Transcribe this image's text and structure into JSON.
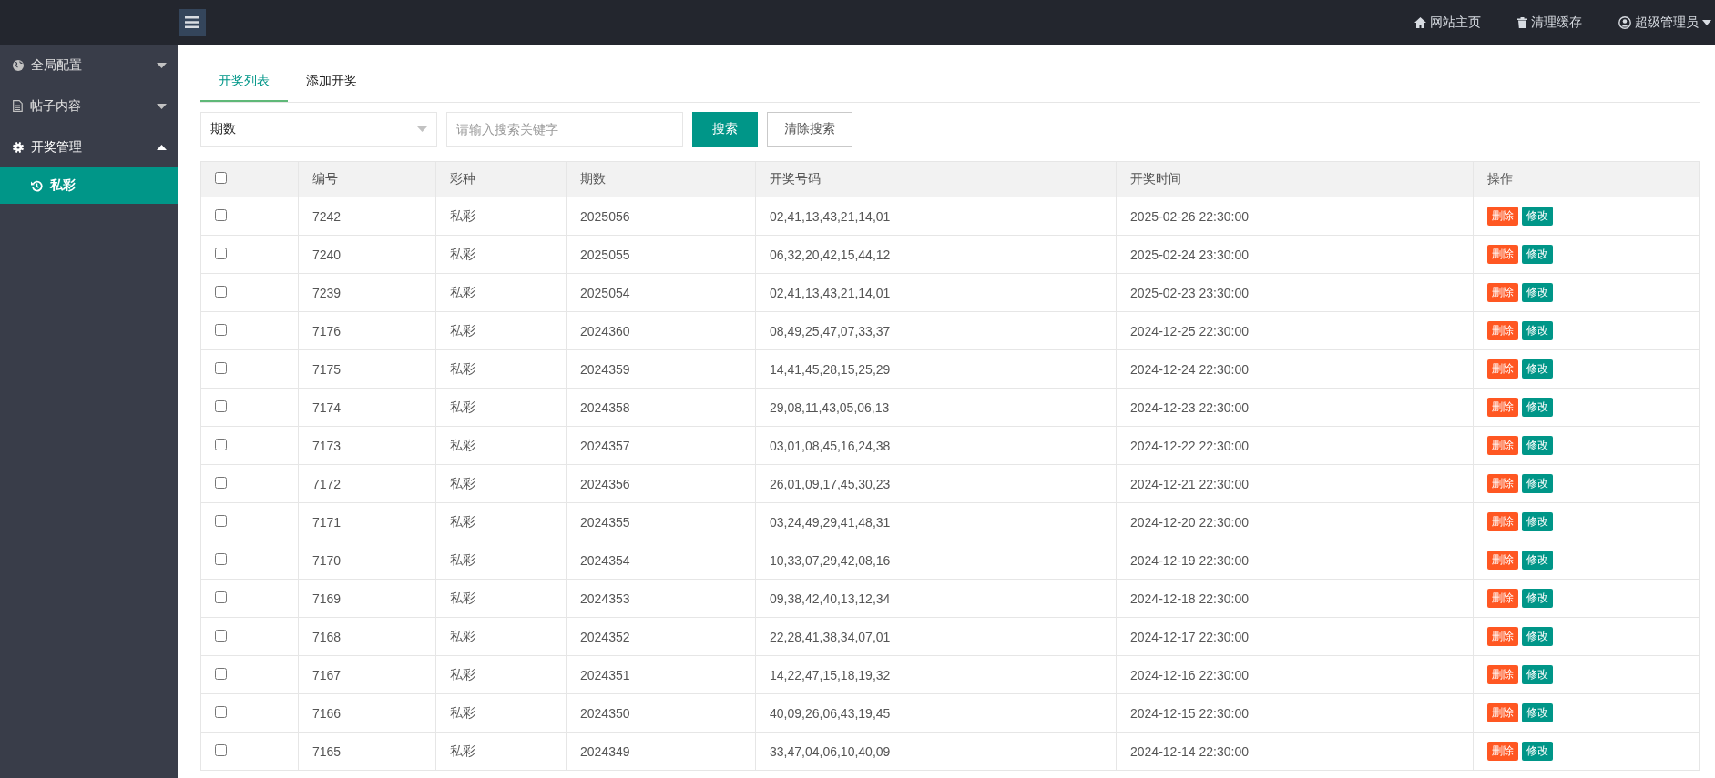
{
  "header": {
    "links": [
      {
        "kind": "home",
        "label": "网站主页"
      },
      {
        "kind": "trash",
        "label": "清理缓存"
      },
      {
        "kind": "user",
        "label": "超级管理员"
      }
    ]
  },
  "sidebar": {
    "items": [
      {
        "kind": "globe",
        "label": "全局配置",
        "expanded": false
      },
      {
        "kind": "file",
        "label": "帖子内容",
        "expanded": false
      },
      {
        "kind": "gear",
        "label": "开奖管理",
        "expanded": true,
        "children": [
          {
            "kind": "history",
            "label": "私彩",
            "selected": true
          }
        ]
      }
    ]
  },
  "tabs": [
    {
      "label": "开奖列表",
      "selected": true
    },
    {
      "label": "添加开奖",
      "selected": false
    }
  ],
  "search": {
    "select_value": "期数",
    "placeholder": "请输入搜索关键字",
    "search_button": "搜索",
    "clear_button": "清除搜索"
  },
  "table": {
    "all_checked": false,
    "columns": [
      "编号",
      "彩种",
      "期数",
      "开奖号码",
      "开奖时间",
      "操作"
    ],
    "rows": [
      {
        "checked": false,
        "id": "7242",
        "type": "私彩",
        "period": "2025056",
        "numbers": "02,41,13,43,21,14,01",
        "time": "2025-02-26 22:30:00",
        "actions": [
          "删除",
          "修改"
        ]
      },
      {
        "checked": false,
        "id": "7240",
        "type": "私彩",
        "period": "2025055",
        "numbers": "06,32,20,42,15,44,12",
        "time": "2025-02-24 23:30:00",
        "actions": [
          "删除",
          "修改"
        ]
      },
      {
        "checked": false,
        "id": "7239",
        "type": "私彩",
        "period": "2025054",
        "numbers": "02,41,13,43,21,14,01",
        "time": "2025-02-23 23:30:00",
        "actions": [
          "删除",
          "修改"
        ]
      },
      {
        "checked": false,
        "id": "7176",
        "type": "私彩",
        "period": "2024360",
        "numbers": "08,49,25,47,07,33,37",
        "time": "2024-12-25 22:30:00",
        "actions": [
          "删除",
          "修改"
        ]
      },
      {
        "checked": false,
        "id": "7175",
        "type": "私彩",
        "period": "2024359",
        "numbers": "14,41,45,28,15,25,29",
        "time": "2024-12-24 22:30:00",
        "actions": [
          "删除",
          "修改"
        ]
      },
      {
        "checked": false,
        "id": "7174",
        "type": "私彩",
        "period": "2024358",
        "numbers": "29,08,11,43,05,06,13",
        "time": "2024-12-23 22:30:00",
        "actions": [
          "删除",
          "修改"
        ]
      },
      {
        "checked": false,
        "id": "7173",
        "type": "私彩",
        "period": "2024357",
        "numbers": "03,01,08,45,16,24,38",
        "time": "2024-12-22 22:30:00",
        "actions": [
          "删除",
          "修改"
        ]
      },
      {
        "checked": false,
        "id": "7172",
        "type": "私彩",
        "period": "2024356",
        "numbers": "26,01,09,17,45,30,23",
        "time": "2024-12-21 22:30:00",
        "actions": [
          "删除",
          "修改"
        ]
      },
      {
        "checked": false,
        "id": "7171",
        "type": "私彩",
        "period": "2024355",
        "numbers": "03,24,49,29,41,48,31",
        "time": "2024-12-20 22:30:00",
        "actions": [
          "删除",
          "修改"
        ]
      },
      {
        "checked": false,
        "id": "7170",
        "type": "私彩",
        "period": "2024354",
        "numbers": "10,33,07,29,42,08,16",
        "time": "2024-12-19 22:30:00",
        "actions": [
          "删除",
          "修改"
        ]
      },
      {
        "checked": false,
        "id": "7169",
        "type": "私彩",
        "period": "2024353",
        "numbers": "09,38,42,40,13,12,34",
        "time": "2024-12-18 22:30:00",
        "actions": [
          "删除",
          "修改"
        ]
      },
      {
        "checked": false,
        "id": "7168",
        "type": "私彩",
        "period": "2024352",
        "numbers": "22,28,41,38,34,07,01",
        "time": "2024-12-17 22:30:00",
        "actions": [
          "删除",
          "修改"
        ]
      },
      {
        "checked": false,
        "id": "7167",
        "type": "私彩",
        "period": "2024351",
        "numbers": "14,22,47,15,18,19,32",
        "time": "2024-12-16 22:30:00",
        "actions": [
          "删除",
          "修改"
        ]
      },
      {
        "checked": false,
        "id": "7166",
        "type": "私彩",
        "period": "2024350",
        "numbers": "40,09,26,06,43,19,45",
        "time": "2024-12-15 22:30:00",
        "actions": [
          "删除",
          "修改"
        ]
      },
      {
        "checked": false,
        "id": "7165",
        "type": "私彩",
        "period": "2024349",
        "numbers": "33,47,04,06,10,40,09",
        "time": "2024-12-14 22:30:00",
        "actions": [
          "删除",
          "修改"
        ]
      }
    ]
  }
}
